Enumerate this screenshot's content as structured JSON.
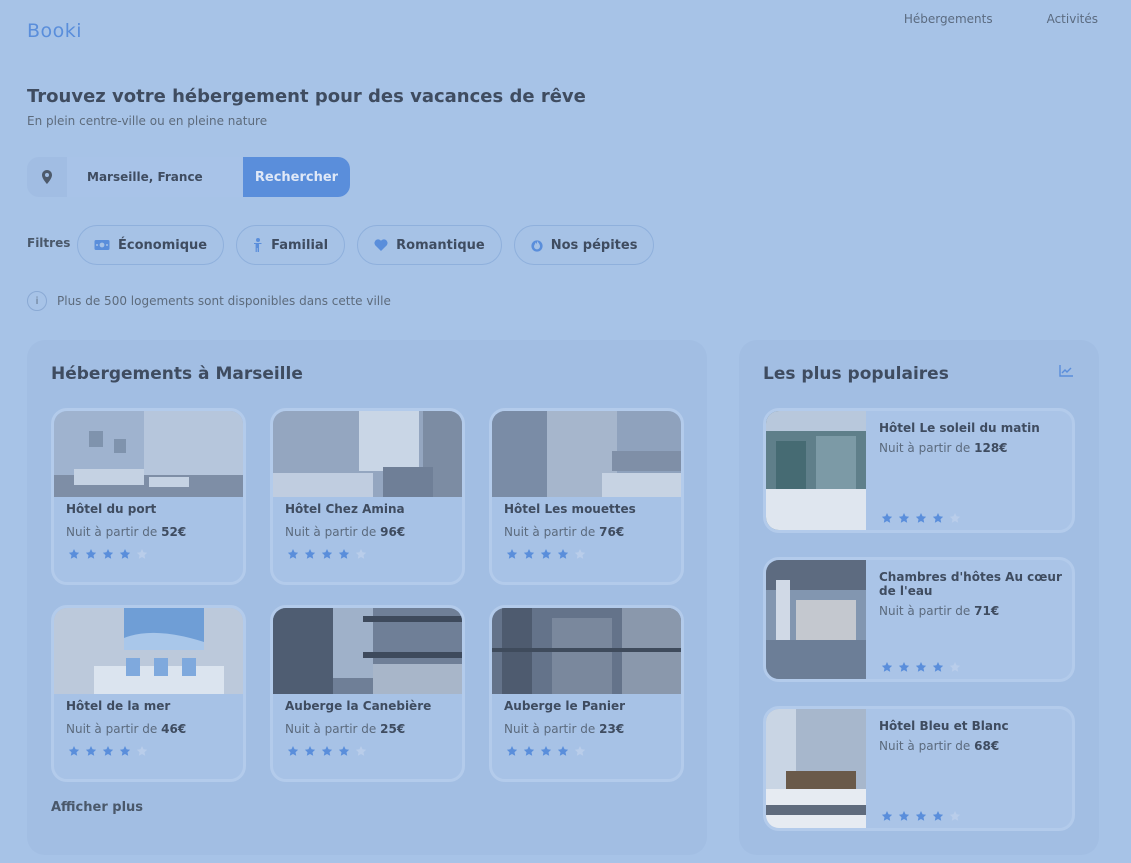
{
  "header": {
    "logo": "Booki",
    "nav": [
      "Hébergements",
      "Activités"
    ]
  },
  "hero": {
    "title": "Trouvez votre hébergement pour des vacances de rêve",
    "subtitle": "En plein centre-ville ou en pleine nature"
  },
  "search": {
    "value": "Marseille, France",
    "button": "Rechercher"
  },
  "filters": {
    "label": "Filtres",
    "items": [
      "Économique",
      "Familial",
      "Romantique",
      "Nos pépites"
    ]
  },
  "info": {
    "icon": "i",
    "text": "Plus de 500 logements sont disponibles dans cette ville"
  },
  "listings": {
    "title": "Hébergements à Marseille",
    "price_prefix": "Nuit à partir de",
    "items": [
      {
        "name": "Hôtel du port",
        "price": "52€",
        "rating": 4
      },
      {
        "name": "Hôtel Chez Amina",
        "price": "96€",
        "rating": 4
      },
      {
        "name": "Hôtel Les mouettes",
        "price": "76€",
        "rating": 4
      },
      {
        "name": "Hôtel de la mer",
        "price": "46€",
        "rating": 4
      },
      {
        "name": "Auberge la Canebière",
        "price": "25€",
        "rating": 4
      },
      {
        "name": "Auberge le Panier",
        "price": "23€",
        "rating": 4
      }
    ],
    "more": "Afficher plus"
  },
  "popular": {
    "title": "Les plus populaires",
    "items": [
      {
        "name": "Hôtel Le soleil du matin",
        "price": "128€",
        "rating": 4
      },
      {
        "name": "Chambres d'hôtes Au cœur de l'eau",
        "price": "71€",
        "rating": 4
      },
      {
        "name": "Hôtel Bleu et Blanc",
        "price": "68€",
        "rating": 4
      }
    ]
  },
  "colors": {
    "accent": "#5a8edb",
    "star_filled": "#5a8edb",
    "star_empty": "#b9cdea"
  }
}
